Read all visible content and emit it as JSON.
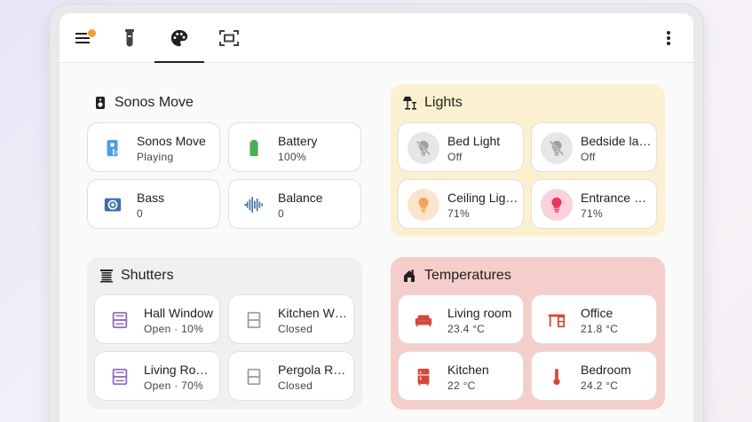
{
  "toolbar": {
    "tabs": [
      {
        "icon": "menu-icon",
        "badge": true
      },
      {
        "icon": "test-tube-icon"
      },
      {
        "icon": "palette-icon",
        "active": true
      },
      {
        "icon": "fullscreen-icon"
      }
    ],
    "more_icon": "more-vertical-icon",
    "badge_color": "#f0a030"
  },
  "sections": {
    "sonos": {
      "title": "Sonos Move",
      "icon": "speaker-icon",
      "tiles": [
        {
          "name": "Sonos Move",
          "state": "Playing",
          "icon": "speaker-play-icon",
          "color": "#4a9fe0"
        },
        {
          "name": "Battery",
          "state": "100%",
          "icon": "battery-icon",
          "color": "#4caf50"
        },
        {
          "name": "Bass",
          "state": "0",
          "icon": "surround-icon",
          "color": "#3f6fa8"
        },
        {
          "name": "Balance",
          "state": "0",
          "icon": "waveform-icon",
          "color": "#3f6fa8"
        }
      ]
    },
    "lights": {
      "title": "Lights",
      "icon": "floor-lamp-icon",
      "background": "#fbf0d0",
      "tiles": [
        {
          "name": "Bed Light",
          "state": "Off",
          "icon": "lightbulb-off-icon",
          "color": "#9e9e9e"
        },
        {
          "name": "Bedside lamp",
          "state": "Off",
          "icon": "lightbulb-off-icon",
          "color": "#9e9e9e"
        },
        {
          "name": "Ceiling Lights",
          "state": "71%",
          "icon": "lightbulb-icon",
          "color": "#f2a456"
        },
        {
          "name": "Entrance Lamp",
          "state": "71%",
          "icon": "lightbulb-icon",
          "color": "#e8365b"
        }
      ]
    },
    "shutters": {
      "title": "Shutters",
      "icon": "blinds-icon",
      "background": "#f0f0f0",
      "tiles": [
        {
          "name": "Hall Window",
          "state": "Open · 10%",
          "icon": "window-shutter-open-icon",
          "color": "#8e6bbd"
        },
        {
          "name": "Kitchen Window",
          "state": "Closed",
          "icon": "window-shutter-closed-icon",
          "color": "#9e9e9e"
        },
        {
          "name": "Living Room Window",
          "state": "Open · 70%",
          "icon": "window-shutter-open-icon",
          "color": "#8e6bbd"
        },
        {
          "name": "Pergola Roof",
          "state": "Closed",
          "icon": "window-shutter-closed-icon",
          "color": "#9e9e9e"
        }
      ]
    },
    "temperatures": {
      "title": "Temperatures",
      "icon": "home-thermometer-icon",
      "background": "#f5cdca",
      "tiles": [
        {
          "name": "Living room",
          "state": "23.4 °C",
          "icon": "sofa-icon",
          "color": "#d5473b"
        },
        {
          "name": "Office",
          "state": "21.8 °C",
          "icon": "desk-icon",
          "color": "#d5473b"
        },
        {
          "name": "Kitchen",
          "state": "22 °C",
          "icon": "fridge-icon",
          "color": "#d5473b"
        },
        {
          "name": "Bedroom",
          "state": "24.2 °C",
          "icon": "thermometer-icon",
          "color": "#d5473b"
        }
      ]
    }
  }
}
